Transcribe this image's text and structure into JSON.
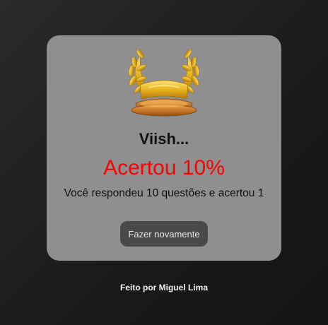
{
  "result": {
    "icon": "laurel-crown-icon",
    "subtitle": "Viish...",
    "score_text": "Acertou 10%",
    "detail_text": "Você respondeu 10 questões e acertou 1",
    "retry_label": "Fazer novamente"
  },
  "footer": {
    "credit": "Feito por Miguel Lima"
  },
  "colors": {
    "background": "#1f1f1f",
    "card": "#8f8f8f",
    "score": "#ff0000",
    "button": "#4a4a4a",
    "gold": "#e5b21b"
  }
}
